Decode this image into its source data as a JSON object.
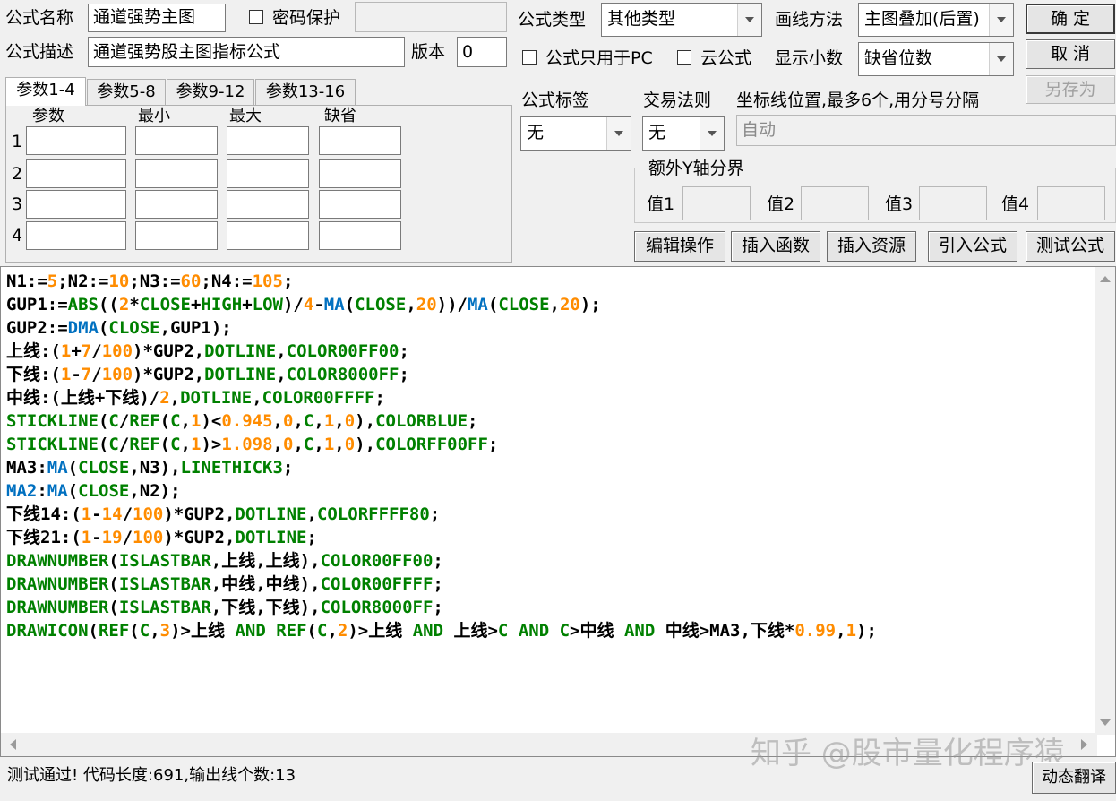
{
  "header": {
    "formula_name_label": "公式名称",
    "formula_name_value": "通道强势主图",
    "password_label": "密码保护",
    "password_value": "",
    "formula_desc_label": "公式描述",
    "formula_desc_value": "通道强势股主图指标公式",
    "version_label": "版本",
    "version_value": "0"
  },
  "settings": {
    "formula_type_label": "公式类型",
    "formula_type_value": "其他类型",
    "draw_method_label": "画线方法",
    "draw_method_value": "主图叠加(后置)",
    "pc_only_label": "公式只用于PC",
    "cloud_label": "云公式",
    "decimals_label": "显示小数",
    "decimals_value": "缺省位数",
    "tag_label": "公式标签",
    "tag_value": "无",
    "trade_rule_label": "交易法则",
    "trade_rule_value": "无",
    "axis_label": "坐标线位置,最多6个,用分号分隔",
    "axis_placeholder": "自动",
    "extra_y_label": "额外Y轴分界",
    "extra_y": [
      {
        "label": "值1",
        "value": ""
      },
      {
        "label": "值2",
        "value": ""
      },
      {
        "label": "值3",
        "value": ""
      },
      {
        "label": "值4",
        "value": ""
      }
    ]
  },
  "buttons": {
    "ok": "确 定",
    "cancel": "取 消",
    "save_as": "另存为",
    "edit_ops": "编辑操作",
    "insert_func": "插入函数",
    "insert_res": "插入资源",
    "import_formula": "引入公式",
    "test_formula": "测试公式",
    "dynamic_translate": "动态翻译"
  },
  "params": {
    "tabs": [
      "参数1-4",
      "参数5-8",
      "参数9-12",
      "参数13-16"
    ],
    "columns": [
      "参数",
      "最小",
      "最大",
      "缺省"
    ],
    "rows": [
      "1",
      "2",
      "3",
      "4"
    ]
  },
  "colors": {
    "number": "#ff8c00",
    "function": "#0070c0",
    "style": "#008000",
    "text": "#000000"
  },
  "code_lines": [
    [
      [
        "t",
        "N1:="
      ],
      [
        "n",
        "5"
      ],
      [
        "t",
        ";N2:="
      ],
      [
        "n",
        "10"
      ],
      [
        "t",
        ";N3:="
      ],
      [
        "n",
        "60"
      ],
      [
        "t",
        ";N4:="
      ],
      [
        "n",
        "105"
      ],
      [
        "t",
        ";"
      ]
    ],
    [
      [
        "t",
        "GUP1:="
      ],
      [
        "s",
        "ABS"
      ],
      [
        "t",
        "(("
      ],
      [
        "n",
        "2"
      ],
      [
        "t",
        "*"
      ],
      [
        "s",
        "CLOSE"
      ],
      [
        "t",
        "+"
      ],
      [
        "s",
        "HIGH"
      ],
      [
        "t",
        "+"
      ],
      [
        "s",
        "LOW"
      ],
      [
        "t",
        ")/"
      ],
      [
        "n",
        "4"
      ],
      [
        "t",
        "-"
      ],
      [
        "f",
        "MA"
      ],
      [
        "t",
        "("
      ],
      [
        "s",
        "CLOSE"
      ],
      [
        "t",
        ","
      ],
      [
        "n",
        "20"
      ],
      [
        "t",
        "))/"
      ],
      [
        "f",
        "MA"
      ],
      [
        "t",
        "("
      ],
      [
        "s",
        "CLOSE"
      ],
      [
        "t",
        ","
      ],
      [
        "n",
        "20"
      ],
      [
        "t",
        ");"
      ]
    ],
    [
      [
        "t",
        "GUP2:="
      ],
      [
        "f",
        "DMA"
      ],
      [
        "t",
        "("
      ],
      [
        "s",
        "CLOSE"
      ],
      [
        "t",
        ",GUP1);"
      ]
    ],
    [
      [
        "t",
        "上线:("
      ],
      [
        "n",
        "1"
      ],
      [
        "t",
        "+"
      ],
      [
        "n",
        "7"
      ],
      [
        "t",
        "/"
      ],
      [
        "n",
        "100"
      ],
      [
        "t",
        ")*GUP2,"
      ],
      [
        "s",
        "DOTLINE"
      ],
      [
        "t",
        ","
      ],
      [
        "s",
        "COLOR00FF00"
      ],
      [
        "t",
        ";"
      ]
    ],
    [
      [
        "t",
        "下线:("
      ],
      [
        "n",
        "1"
      ],
      [
        "t",
        "-"
      ],
      [
        "n",
        "7"
      ],
      [
        "t",
        "/"
      ],
      [
        "n",
        "100"
      ],
      [
        "t",
        ")*GUP2,"
      ],
      [
        "s",
        "DOTLINE"
      ],
      [
        "t",
        ","
      ],
      [
        "s",
        "COLOR8000FF"
      ],
      [
        "t",
        ";"
      ]
    ],
    [
      [
        "t",
        "中线:(上线+下线)/"
      ],
      [
        "n",
        "2"
      ],
      [
        "t",
        ","
      ],
      [
        "s",
        "DOTLINE"
      ],
      [
        "t",
        ","
      ],
      [
        "s",
        "COLOR00FFFF"
      ],
      [
        "t",
        ";"
      ]
    ],
    [
      [
        "s",
        "STICKLINE"
      ],
      [
        "t",
        "("
      ],
      [
        "s",
        "C"
      ],
      [
        "t",
        "/"
      ],
      [
        "s",
        "REF"
      ],
      [
        "t",
        "("
      ],
      [
        "s",
        "C"
      ],
      [
        "t",
        ","
      ],
      [
        "n",
        "1"
      ],
      [
        "t",
        ")<"
      ],
      [
        "n",
        "0.945"
      ],
      [
        "t",
        ","
      ],
      [
        "n",
        "0"
      ],
      [
        "t",
        ","
      ],
      [
        "s",
        "C"
      ],
      [
        "t",
        ","
      ],
      [
        "n",
        "1"
      ],
      [
        "t",
        ","
      ],
      [
        "n",
        "0"
      ],
      [
        "t",
        "),"
      ],
      [
        "s",
        "COLORBLUE"
      ],
      [
        "t",
        ";"
      ]
    ],
    [
      [
        "s",
        "STICKLINE"
      ],
      [
        "t",
        "("
      ],
      [
        "s",
        "C"
      ],
      [
        "t",
        "/"
      ],
      [
        "s",
        "REF"
      ],
      [
        "t",
        "("
      ],
      [
        "s",
        "C"
      ],
      [
        "t",
        ","
      ],
      [
        "n",
        "1"
      ],
      [
        "t",
        ")>"
      ],
      [
        "n",
        "1.098"
      ],
      [
        "t",
        ","
      ],
      [
        "n",
        "0"
      ],
      [
        "t",
        ","
      ],
      [
        "s",
        "C"
      ],
      [
        "t",
        ","
      ],
      [
        "n",
        "1"
      ],
      [
        "t",
        ","
      ],
      [
        "n",
        "0"
      ],
      [
        "t",
        "),"
      ],
      [
        "s",
        "COLORFF00FF"
      ],
      [
        "t",
        ";"
      ]
    ],
    [
      [
        "t",
        "MA3:"
      ],
      [
        "f",
        "MA"
      ],
      [
        "t",
        "("
      ],
      [
        "s",
        "CLOSE"
      ],
      [
        "t",
        ",N3),"
      ],
      [
        "s",
        "LINETHICK3"
      ],
      [
        "t",
        ";"
      ]
    ],
    [
      [
        "f",
        "MA2"
      ],
      [
        "t",
        ":"
      ],
      [
        "f",
        "MA"
      ],
      [
        "t",
        "("
      ],
      [
        "s",
        "CLOSE"
      ],
      [
        "t",
        ",N2);"
      ]
    ],
    [
      [
        "t",
        "下线14:("
      ],
      [
        "n",
        "1"
      ],
      [
        "t",
        "-"
      ],
      [
        "n",
        "14"
      ],
      [
        "t",
        "/"
      ],
      [
        "n",
        "100"
      ],
      [
        "t",
        ")*GUP2,"
      ],
      [
        "s",
        "DOTLINE"
      ],
      [
        "t",
        ","
      ],
      [
        "s",
        "COLORFFFF80"
      ],
      [
        "t",
        ";"
      ]
    ],
    [
      [
        "t",
        "下线21:("
      ],
      [
        "n",
        "1"
      ],
      [
        "t",
        "-"
      ],
      [
        "n",
        "19"
      ],
      [
        "t",
        "/"
      ],
      [
        "n",
        "100"
      ],
      [
        "t",
        ")*GUP2,"
      ],
      [
        "s",
        "DOTLINE"
      ],
      [
        "t",
        ";"
      ]
    ],
    [
      [
        "s",
        "DRAWNUMBER"
      ],
      [
        "t",
        "("
      ],
      [
        "s",
        "ISLASTBAR"
      ],
      [
        "t",
        ",上线,上线),"
      ],
      [
        "s",
        "COLOR00FF00"
      ],
      [
        "t",
        ";"
      ]
    ],
    [
      [
        "s",
        "DRAWNUMBER"
      ],
      [
        "t",
        "("
      ],
      [
        "s",
        "ISLASTBAR"
      ],
      [
        "t",
        ",中线,中线),"
      ],
      [
        "s",
        "COLOR00FFFF"
      ],
      [
        "t",
        ";"
      ]
    ],
    [
      [
        "s",
        "DRAWNUMBER"
      ],
      [
        "t",
        "("
      ],
      [
        "s",
        "ISLASTBAR"
      ],
      [
        "t",
        ",下线,下线),"
      ],
      [
        "s",
        "COLOR8000FF"
      ],
      [
        "t",
        ";"
      ]
    ],
    [
      [
        "s",
        "DRAWICON"
      ],
      [
        "t",
        "("
      ],
      [
        "s",
        "REF"
      ],
      [
        "t",
        "("
      ],
      [
        "s",
        "C"
      ],
      [
        "t",
        ","
      ],
      [
        "n",
        "3"
      ],
      [
        "t",
        ")>上线 "
      ],
      [
        "s",
        "AND"
      ],
      [
        "t",
        " "
      ],
      [
        "s",
        "REF"
      ],
      [
        "t",
        "("
      ],
      [
        "s",
        "C"
      ],
      [
        "t",
        ","
      ],
      [
        "n",
        "2"
      ],
      [
        "t",
        ")>上线 "
      ],
      [
        "s",
        "AND"
      ],
      [
        "t",
        " 上线>"
      ],
      [
        "s",
        "C"
      ],
      [
        "t",
        " "
      ],
      [
        "s",
        "AND"
      ],
      [
        "t",
        " "
      ],
      [
        "s",
        "C"
      ],
      [
        "t",
        ">中线 "
      ],
      [
        "s",
        "AND"
      ],
      [
        "t",
        " 中线>MA3,下线*"
      ],
      [
        "n",
        "0.99"
      ],
      [
        "t",
        ","
      ],
      [
        "n",
        "1"
      ],
      [
        "t",
        ");"
      ]
    ]
  ],
  "status": {
    "text": "测试通过! 代码长度:691,输出线个数:13"
  },
  "watermark": "知乎 @股市量化程序猿"
}
